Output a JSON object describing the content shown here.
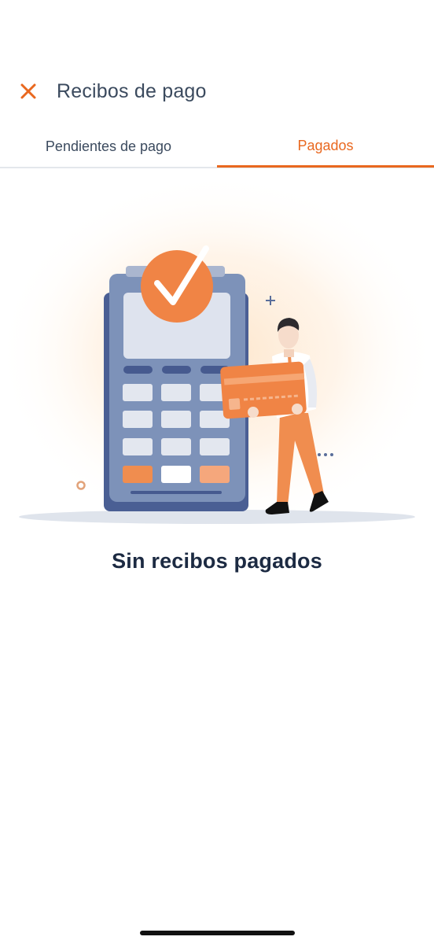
{
  "header": {
    "title": "Recibos de pago",
    "close_icon": "close-icon"
  },
  "tabs": [
    {
      "label": "Pendientes de pago",
      "active": false
    },
    {
      "label": "Pagados",
      "active": true
    }
  ],
  "empty_state": {
    "message": "Sin recibos pagados",
    "illustration": "payment-terminal-illustration"
  },
  "colors": {
    "accent": "#e9681f",
    "title_text": "#3b4a5e",
    "empty_text": "#1c2a42",
    "terminal_body": "#7d92b9",
    "terminal_dark": "#4a5f94"
  }
}
